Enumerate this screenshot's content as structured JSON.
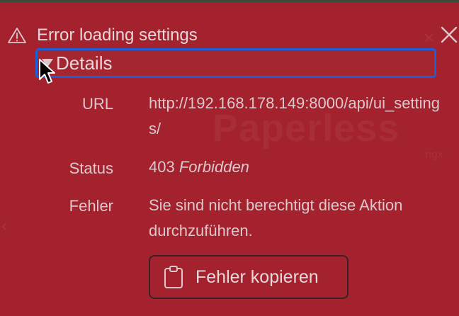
{
  "toast": {
    "title": "Error loading settings",
    "warning_icon": "warning-triangle-icon",
    "close_icon": "close-icon"
  },
  "details": {
    "summary_label": "Details",
    "url_label": "URL",
    "url_value": "http://192.168.178.149:8000/api/ui_settings/",
    "status_label": "Status",
    "status_code": "403",
    "status_text": "Forbidden",
    "error_label": "Fehler",
    "error_message": "Sie sind nicht berechtigt diese Aktion durchzuführen."
  },
  "copy_button": {
    "label": "Fehler kopieren",
    "icon": "clipboard-icon"
  },
  "background": {
    "watermark_text": "Paperless",
    "watermark_sub": "ngx"
  },
  "colors": {
    "toast_background": "#a3222d",
    "focus_ring": "#1d5fd6",
    "text": "#dcc8cc"
  }
}
